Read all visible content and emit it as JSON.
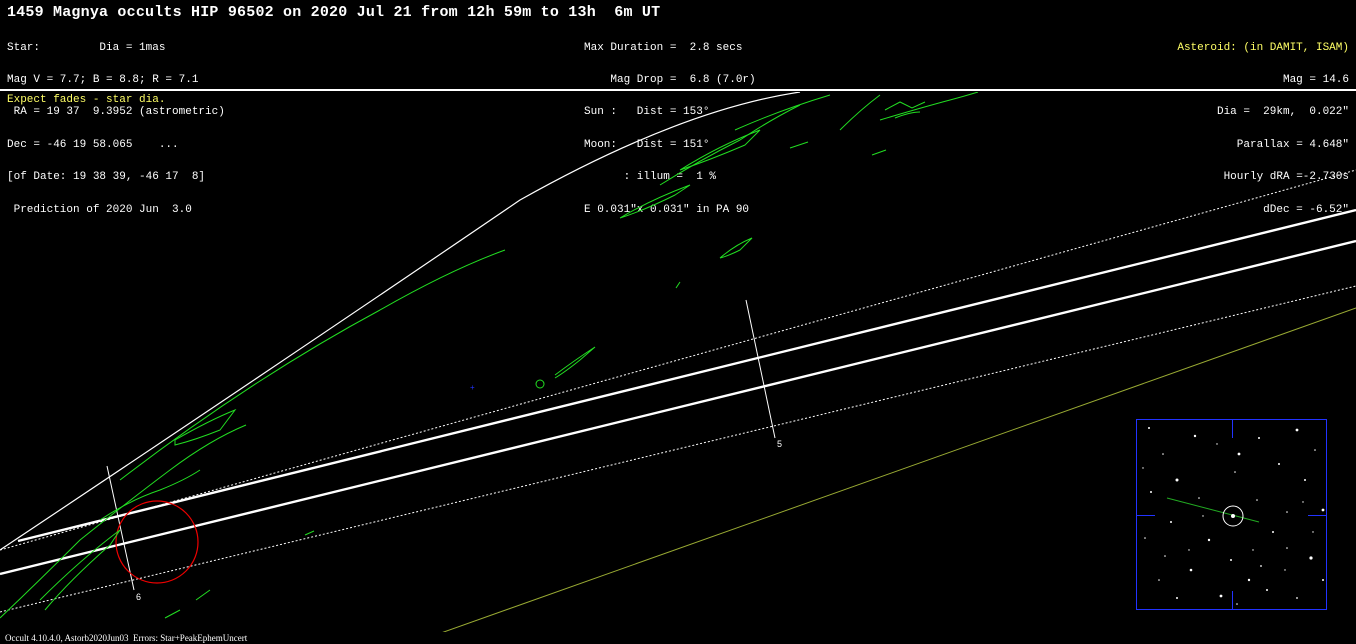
{
  "title": "1459 Magnya occults HIP 96502 on 2020 Jul 21 from 12h 59m to 13h  6m UT",
  "star_info": [
    "Star:         Dia = 1mas",
    "Mag V = 7.7; B = 8.8; R = 7.1",
    " RA = 19 37  9.3952 (astrometric)",
    "Dec = -46 19 58.065    ...",
    "[of Date: 19 38 39, -46 17  8]",
    " Prediction of 2020 Jun  3.0"
  ],
  "event_info": [
    "Max Duration =  2.8 secs",
    "    Mag Drop =  6.8 (7.0r)",
    "Sun :   Dist = 153°",
    "Moon:   Dist = 151°",
    "      : illum =  1 %",
    "E 0.031\"x 0.031\" in PA 90"
  ],
  "asteroid_header": "Asteroid: (in DAMIT, ISAM)",
  "asteroid_info": [
    "Mag = 14.6",
    "Dia =  29km,  0.022\"",
    "Parallax = 4.648\"",
    "Hourly dRA =-2.730s",
    "dDec = -6.52\""
  ],
  "note": "Expect fades - star dia.",
  "footer": "Occult 4.10.4.0, Astorb2020Jun03  Errors: Star+PeakEphemUncert",
  "time_markers": [
    "5",
    "6"
  ],
  "colors": {
    "coast": "#22dd22",
    "path": "#ffffff",
    "limb": "#ffffff",
    "circle": "#ee0000",
    "olive": "#99aa33",
    "finder_border": "#2233ff",
    "header_yellow": "#ffff66"
  },
  "icons": [
    "target-circle-icon",
    "site-marker-icon"
  ]
}
